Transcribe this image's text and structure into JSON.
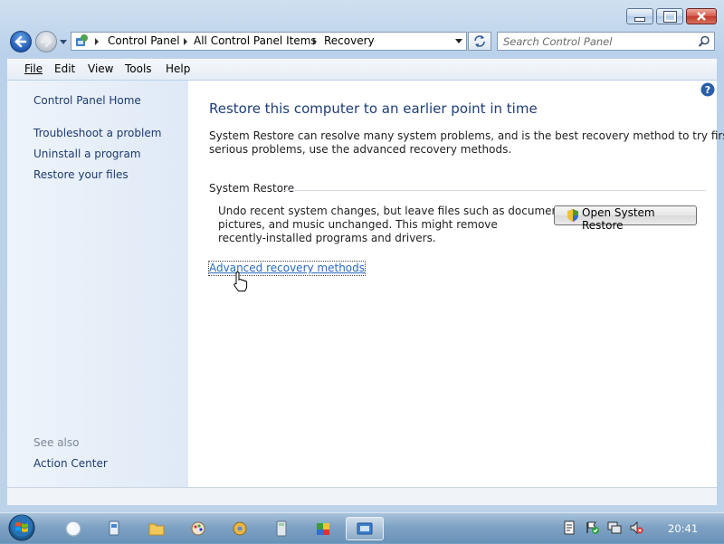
{
  "window": {
    "buttons": {
      "minimize": "minimize-button",
      "maximize": "maximize-button",
      "close": "close-button"
    }
  },
  "nav": {
    "breadcrumbs": [
      "Control Panel",
      "All Control Panel Items",
      "Recovery"
    ],
    "search_placeholder": "Search Control Panel"
  },
  "menu": [
    "File",
    "Edit",
    "View",
    "Tools",
    "Help"
  ],
  "sidebar": {
    "home": "Control Panel Home",
    "links": [
      "Troubleshoot a problem",
      "Uninstall a program",
      "Restore your files"
    ],
    "see_also_title": "See also",
    "see_also_links": [
      "Action Center"
    ]
  },
  "main": {
    "title": "Restore this computer to an earlier point in time",
    "intro_line1": "System Restore can resolve many system problems, and is the best recovery method to try first. For",
    "intro_line2": "serious problems, use the advanced recovery methods.",
    "section_title": "System Restore",
    "section_desc_line1": "Undo recent system changes, but leave files such as documents,",
    "section_desc_line2": "pictures, and music unchanged. This might remove",
    "section_desc_line3": "recently-installed programs and drivers.",
    "open_button": "Open System Restore",
    "advanced_link": "Advanced recovery methods"
  },
  "taskbar": {
    "clock": "20:41"
  },
  "colors": {
    "link": "#1e3b6e",
    "title": "#1e3d7a",
    "accent_link": "#2a6ac1"
  }
}
